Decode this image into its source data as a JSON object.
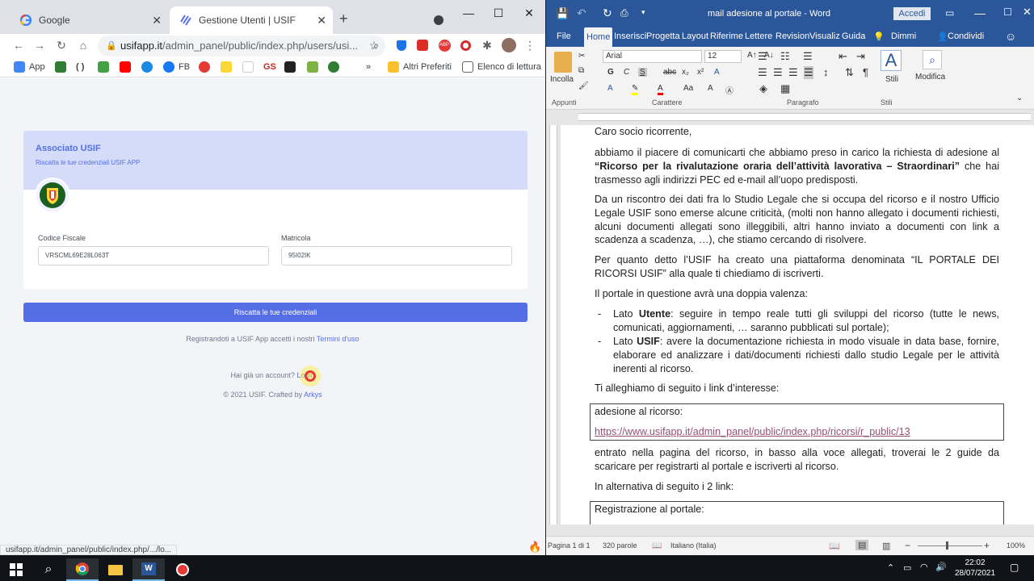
{
  "chrome": {
    "tabs": [
      {
        "title": "Google",
        "active": false
      },
      {
        "title": "Gestione Utenti | USIF",
        "active": true
      }
    ],
    "new_tab_symbol": "+",
    "url_host": "usifapp.it",
    "url_path": "/admin_panel/public/index.php/users/usi...",
    "bookmarks": [
      {
        "label": "App",
        "color": "#4285f4"
      },
      {
        "label": "",
        "color": "#2e7d32"
      },
      {
        "label": "( )",
        "color": ""
      },
      {
        "label": "",
        "color": "#43a047"
      },
      {
        "label": "",
        "color": "#ff0000"
      },
      {
        "label": "",
        "color": "#1e88e5"
      },
      {
        "label": "FB",
        "color": "#1877f2"
      },
      {
        "label": "",
        "color": "#e53935"
      },
      {
        "label": "",
        "color": "#fdd835"
      },
      {
        "label": "GS",
        "color": "#c62828"
      },
      {
        "label": "",
        "color": "#222222"
      },
      {
        "label": "",
        "color": "#7cb342"
      },
      {
        "label": "",
        "color": "#2e7d32"
      }
    ],
    "bookmark_overflow": "»",
    "other_bookmarks": "Altri Preferiti",
    "reading_list": "Elenco di lettura",
    "status_url": "usifapp.it/admin_panel/public/index.php/.../lo..."
  },
  "usif_page": {
    "card_title": "Associato USIF",
    "card_subtitle": "Riscatta le tue credenziali USIF APP",
    "logo_text": "USIF",
    "codice_fiscale_label": "Codice Fiscale",
    "codice_fiscale_value": "VRSCML69E28L063T",
    "matricola_label": "Matricola",
    "matricola_value": "95I02IK",
    "claim_button": "Riscatta le tue credenziali",
    "terms_prefix": "Registrandoti a USIF App accetti i nostri",
    "terms_link": "Termini d'uso",
    "account_prefix": "Hai già un account?",
    "login_link": "Login",
    "footer_prefix": "© 2021 USIF. Crafted by",
    "footer_link": "Arkys"
  },
  "word": {
    "title": "mail adesione al portale  -  Word",
    "sign_in": "Accedi",
    "tabs": [
      "File",
      "Home",
      "Inserisci",
      "Progetta",
      "Layout",
      "Riferime",
      "Lettere",
      "Revision",
      "Visualiz",
      "Guida",
      "Dimmi",
      "Condividi"
    ],
    "font_name": "Arial",
    "font_size": "12",
    "paste_label": "Incolla",
    "styles_label": "Stili",
    "edit_label": "Modifica",
    "group_clipboard": "Appunti",
    "group_font": "Carattere",
    "group_paragraph": "Paragrafo",
    "group_styles": "Stili",
    "doc": {
      "greeting": "Caro socio ricorrente,",
      "p1_a": "abbiamo il piacere di comunicarti che abbiamo preso in carico la richiesta di adesione al ",
      "p1_bold": "“Ricorso per la rivalutazione oraria dell’attività lavorativa – Straordinari”",
      "p1_b": " che hai trasmesso agli indirizzi PEC ed e-mail all’uopo predisposti.",
      "p2": "Da un riscontro dei dati fra lo Studio Legale che si occupa del ricorso e il nostro Ufficio Legale USIF sono emerse alcune criticità, (molti non hanno allegato i documenti richiesti, alcuni documenti allegati sono illeggibili, altri hanno inviato a documenti con link a scadenza a scadenza, …), che stiamo cercando di risolvere.",
      "p3": "Per quanto detto l’USIF ha creato una piattaforma denominata “IL PORTALE DEI RICORSI USIF” alla quale ti chiediamo di iscriverti.",
      "p4": "Il portale in questione avrà una doppia valenza:",
      "b1_a": "Lato ",
      "b1_bold": "Utente",
      "b1_b": ": seguire in tempo reale tutti gli sviluppi del ricorso (tutte le news, comunicati, aggiornamenti, … saranno pubblicati sul portale);",
      "b2_a": "Lato ",
      "b2_bold": "USIF",
      "b2_b": ": avere la documentazione richiesta in modo visuale in data base, fornire, elaborare ed analizzare i dati/documenti richiesti dallo studio Legale per le attività inerenti al ricorso.",
      "p5": "Ti alleghiamo di seguito i link d’interesse:",
      "box1_title": "adesione al ricorso:",
      "box1_link": "https://www.usifapp.it/admin_panel/public/index.php/ricorsi/r_public/13",
      "p6": "entrato nella pagina del ricorso, in basso alla voce allegati, troverai le 2 guide da scaricare per registrarti al portale e iscriverti al ricorso.",
      "p7": "In alternativa di seguito i 2 link:",
      "box2_title": "Registrazione al portale:"
    },
    "status_page": "Pagina 1 di 1",
    "status_words": "320 parole",
    "status_lang": "Italiano (Italia)",
    "zoom": "100%"
  },
  "taskbar": {
    "time": "22:02",
    "date": "28/07/2021"
  }
}
